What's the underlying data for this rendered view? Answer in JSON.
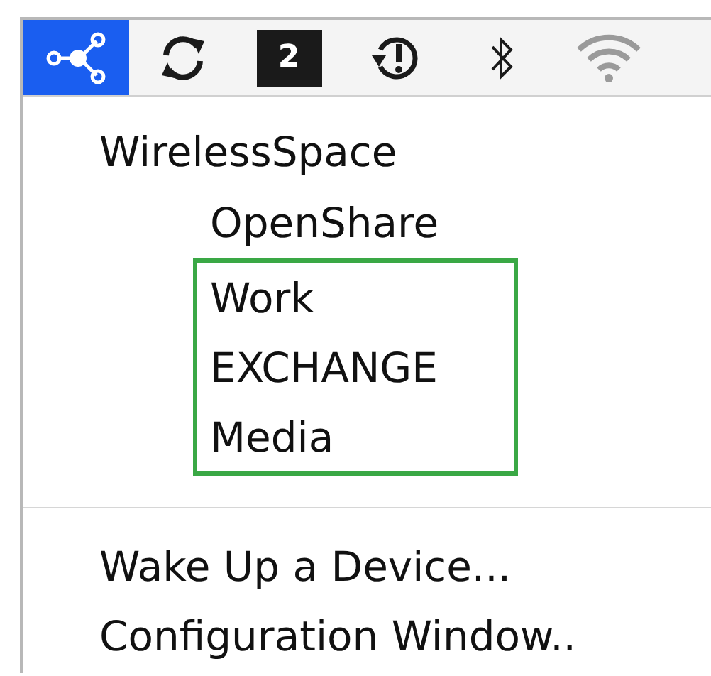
{
  "menu_bar": {
    "items": [
      {
        "kind": "share",
        "selected": true
      },
      {
        "kind": "sync",
        "selected": false
      },
      {
        "kind": "spaces",
        "label": "2",
        "selected": false
      },
      {
        "kind": "timemachine",
        "selected": false
      },
      {
        "kind": "bluetooth",
        "selected": false
      },
      {
        "kind": "wifi",
        "selected": false
      }
    ]
  },
  "menu": {
    "tree": [
      {
        "label": "WirelessSpace",
        "outlined": false,
        "children": [
          {
            "label": "OpenShare",
            "outlined": false
          },
          {
            "label": "Work",
            "outlined": true
          },
          {
            "label": "EXCHANGE",
            "outlined": true
          },
          {
            "label": "Media",
            "outlined": true
          }
        ]
      }
    ],
    "actions": [
      "Wake Up a Device...",
      "Configuration Window.."
    ]
  }
}
